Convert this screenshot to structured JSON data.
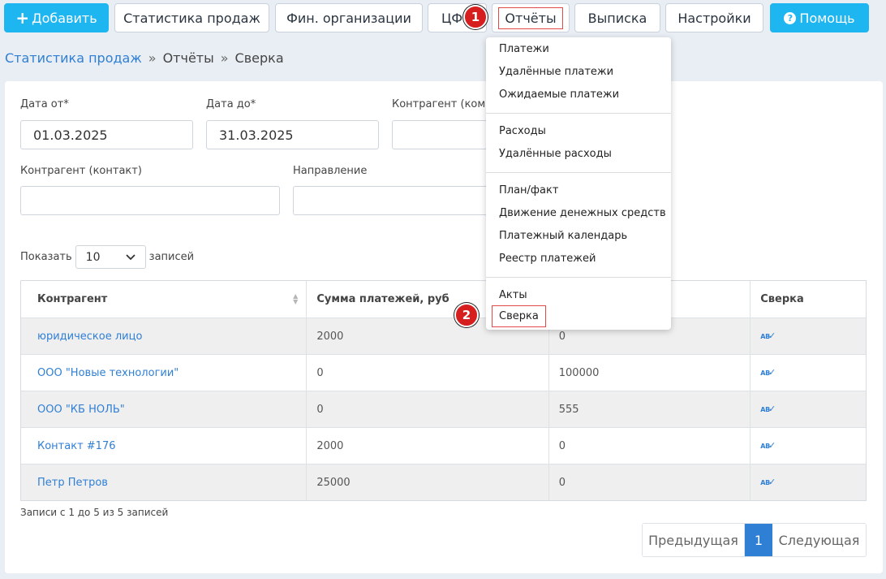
{
  "toolbar": {
    "add_label": "Добавить",
    "sales_stats": "Статистика продаж",
    "fin_orgs": "Фин. организации",
    "cfo": "ЦФ",
    "reports": "Отчёты",
    "statement": "Выписка",
    "settings": "Настройки",
    "help": "Помощь"
  },
  "breadcrumb": {
    "root": "Статистика продаж",
    "sep": "»",
    "reports": "Отчёты",
    "current": "Сверка"
  },
  "filters": {
    "date_from_label": "Дата от*",
    "date_from_value": "01.03.2025",
    "date_to_label": "Дата до*",
    "date_to_value": "31.03.2025",
    "counterparty_company_label": "Контрагент (комп",
    "counterparty_contact_label": "Контрагент (контакт)",
    "direction_label": "Направление"
  },
  "table_controls": {
    "show_label": "Показать",
    "page_size": "10",
    "records_label": "записей"
  },
  "table": {
    "headers": [
      "Контрагент",
      "Сумма платежей, руб",
      "",
      "Сверка"
    ],
    "rows": [
      {
        "name": "юридическое лицо",
        "payments": "2000",
        "col3": "0"
      },
      {
        "name": "ООО \"Новые технологии\"",
        "payments": "0",
        "col3": "100000"
      },
      {
        "name": "ООО \"КБ НОЛЬ\"",
        "payments": "0",
        "col3": "555"
      },
      {
        "name": "Контакт #176",
        "payments": "2000",
        "col3": "0"
      },
      {
        "name": "Петр Петров",
        "payments": "25000",
        "col3": "0"
      }
    ]
  },
  "info": "Записи с 1 до 5 из 5 записей",
  "pagination": {
    "prev": "Предыдущая",
    "page": "1",
    "next": "Следующая"
  },
  "dropdown": {
    "groups": [
      [
        "Платежи",
        "Удалённые платежи",
        "Ожидаемые платежи"
      ],
      [
        "Расходы",
        "Удалённые расходы"
      ],
      [
        "План/факт",
        "Движение денежных средств",
        "Платежный календарь",
        "Реестр платежей"
      ],
      [
        "Акты",
        "Сверка"
      ]
    ]
  },
  "markers": [
    "1",
    "2"
  ],
  "icons": {
    "sort": "sort-icon",
    "reconcile": "ab-check-icon",
    "help": "question-circle-icon",
    "select": "chevron-down-icon"
  },
  "colors": {
    "primary": "#1eb6f0",
    "link": "#2f7fd5",
    "highlight": "#e24a4a",
    "marker": "#d71e1e"
  }
}
